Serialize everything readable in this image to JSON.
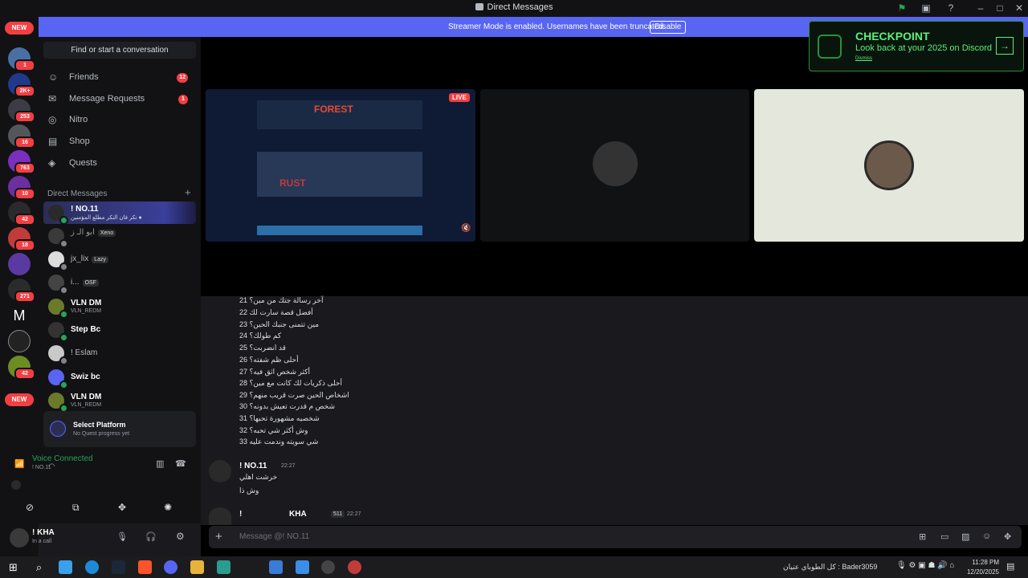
{
  "window": {
    "title": "Direct Messages"
  },
  "banner": {
    "text": "Streamer Mode is enabled. Usernames have been truncated.",
    "button": "Disable"
  },
  "guild_badges": {
    "new_top": "NEW",
    "b1": "1",
    "b2": "2K+",
    "b3": "253",
    "b4": "16",
    "b5": "763",
    "b6": "10",
    "b7": "42",
    "b8": "18",
    "b9": "271",
    "b10": "42",
    "new_bottom": "NEW"
  },
  "sidebar": {
    "search_placeholder": "Find or start a conversation",
    "nav": [
      {
        "label": "Friends",
        "badge": "12"
      },
      {
        "label": "Message Requests",
        "badge": "1"
      },
      {
        "label": "Nitro",
        "badge": ""
      },
      {
        "label": "Shop",
        "badge": ""
      },
      {
        "label": "Quests",
        "badge": ""
      }
    ],
    "dm_header": "Direct Messages",
    "dms": [
      {
        "name": "! NO.11",
        "tag": "",
        "sub": "نكر فان النكر مطلع المؤمنين ●"
      },
      {
        "name": "ابو الـ ز",
        "tag": "Xeno",
        "sub": ""
      },
      {
        "name": "jx_lix",
        "tag": "Lazy",
        "sub": ""
      },
      {
        "name": "i...",
        "tag": "OSF",
        "sub": ""
      },
      {
        "name": "VLN DM",
        "tag": "",
        "sub": "VLN_REDM"
      },
      {
        "name": "Step Bc",
        "tag": "",
        "sub": ""
      },
      {
        "name": "! Eslam",
        "tag": "",
        "sub": ""
      },
      {
        "name": "Swiz bc",
        "tag": "",
        "sub": ""
      },
      {
        "name": "VLN DM",
        "tag": "",
        "sub": "VLN_REDM"
      }
    ],
    "quest": {
      "title": "Select Platform",
      "sub": "No Quest progress yet"
    },
    "voice": {
      "status": "Voice Connected",
      "channel": "! NO.11"
    },
    "user": {
      "name": "! KHA",
      "status": "In a call"
    }
  },
  "stream": {
    "live": "LIVE",
    "game_title": "FOREST",
    "game2": "RUST"
  },
  "checkpoint": {
    "title": "CHECKPOINT",
    "subtitle": "Look back at your 2025 on Discord",
    "dismiss": "Dismiss"
  },
  "chat": {
    "list": [
      "21 آخر رسالة جتك من مين؟",
      "22 أفضل قصة سارت لك",
      "23 مين تتمنى جنبك الحين؟",
      "24 كم طولك؟",
      "25 قد انضربت؟",
      "26 أحلى ظم شفته؟",
      "27 أكثر شخص اثق فيه؟",
      "28 أحلى ذكريات لك كانت مع مين؟",
      "29 اشخاص الحين صرت قريب منهم؟",
      "30 شخص م قدرت تعيش بدونه؟",
      "31 شخصيه مشهورة تحبها؟",
      "32 وش أكثر شي تحبه؟",
      "33 شي سويته وندمت عليه"
    ],
    "msg1": {
      "author": "! NO.11",
      "time": "22:27",
      "lines": [
        "خرشت اهلي",
        "وش ذا"
      ]
    },
    "msg2": {
      "author": "!",
      "name2": "KHA",
      "tag": "511",
      "time": "22:27"
    },
    "composer_placeholder": "Message @! NO.11"
  },
  "taskbar": {
    "tray_text": "كل الطوباي عنيان : Bader3059",
    "time": "11:28 PM",
    "date": "12/20/2025"
  }
}
